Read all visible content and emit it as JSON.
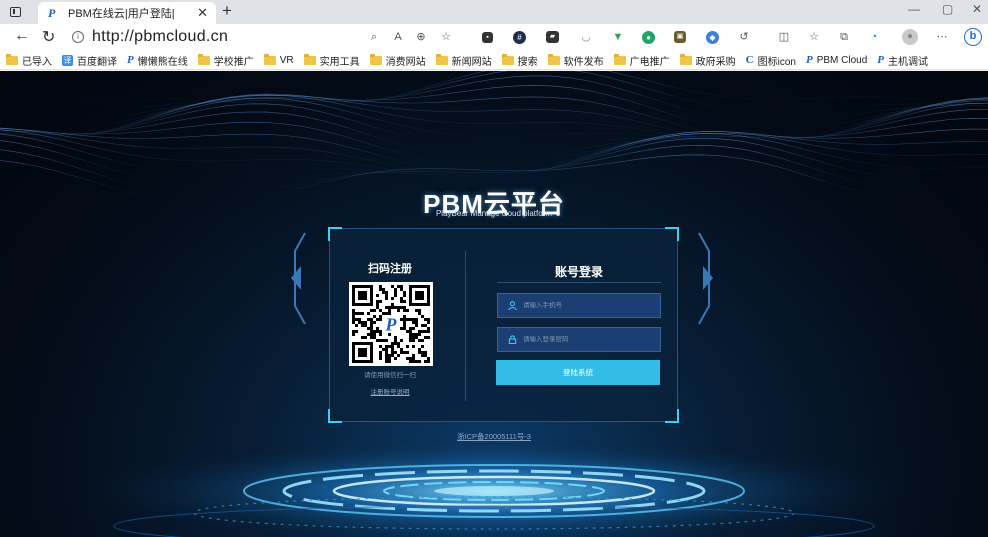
{
  "browser": {
    "tab_title": "PBM在线云|用户登陆|",
    "tab_favicon": "PBM-logo-icon",
    "url": "http://pbmcloud.cn",
    "toolbar_icons": [
      "search-page-icon",
      "read-aloud-icon",
      "zoom-icon",
      "favorite-star-icon",
      "extension-icons",
      "refresh-extension-icon",
      "split-screen-icon",
      "favorites-icon",
      "collections-icon",
      "browser-essentials-icon",
      "profile-avatar-icon",
      "more-icon",
      "bing-icon"
    ]
  },
  "bookmarks": [
    {
      "type": "folder",
      "label": "已导入"
    },
    {
      "type": "app",
      "label": "百度翻译"
    },
    {
      "type": "logo",
      "label": "懒懒熊在线"
    },
    {
      "type": "folder",
      "label": "学校推广"
    },
    {
      "type": "folder",
      "label": "VR"
    },
    {
      "type": "folder",
      "label": "实用工具"
    },
    {
      "type": "folder",
      "label": "消费网站"
    },
    {
      "type": "folder",
      "label": "新闻网站"
    },
    {
      "type": "folder",
      "label": "搜索"
    },
    {
      "type": "folder",
      "label": "软件发布"
    },
    {
      "type": "folder",
      "label": "广电推广"
    },
    {
      "type": "folder",
      "label": "政府采购"
    },
    {
      "type": "c",
      "label": "图标icon"
    },
    {
      "type": "logo",
      "label": "PBM Cloud"
    },
    {
      "type": "logo",
      "label": "主机调试"
    }
  ],
  "page": {
    "brand_title": "PBM云平台",
    "brand_subtitle": "PlayBear Manage cloud platform",
    "qr_section": {
      "title": "扫码注册",
      "hint": "请使用微信扫一扫",
      "link": "注册账号说明"
    },
    "login": {
      "title": "账号登录",
      "phone_placeholder": "请输入手机号",
      "password_placeholder": "请输入登录密码",
      "submit_label": "登陆系统"
    },
    "footer_icp": "浙ICP备20005111号-3"
  },
  "colors": {
    "accent": "#33bde6",
    "field_bg": "#1b3f72",
    "page_bg": "#030b17"
  }
}
